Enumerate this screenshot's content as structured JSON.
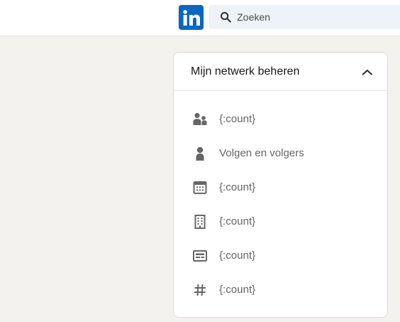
{
  "header": {
    "logo_text": "in",
    "search": {
      "placeholder": "Zoeken",
      "value": ""
    }
  },
  "network_card": {
    "title": "Mijn netwerk beheren",
    "items": [
      {
        "icon": "people-icon",
        "label": "{:count}"
      },
      {
        "icon": "person-icon",
        "label": "Volgen en volgers"
      },
      {
        "icon": "calendar-icon",
        "label": "{:count}"
      },
      {
        "icon": "building-icon",
        "label": "{:count}"
      },
      {
        "icon": "newspaper-icon",
        "label": "{:count}"
      },
      {
        "icon": "hashtag-icon",
        "label": "{:count}"
      }
    ]
  },
  "colors": {
    "brand": "#0a66c2",
    "page_background": "#f4f2ee",
    "search_background": "#edf3f8",
    "icon": "#666666"
  }
}
